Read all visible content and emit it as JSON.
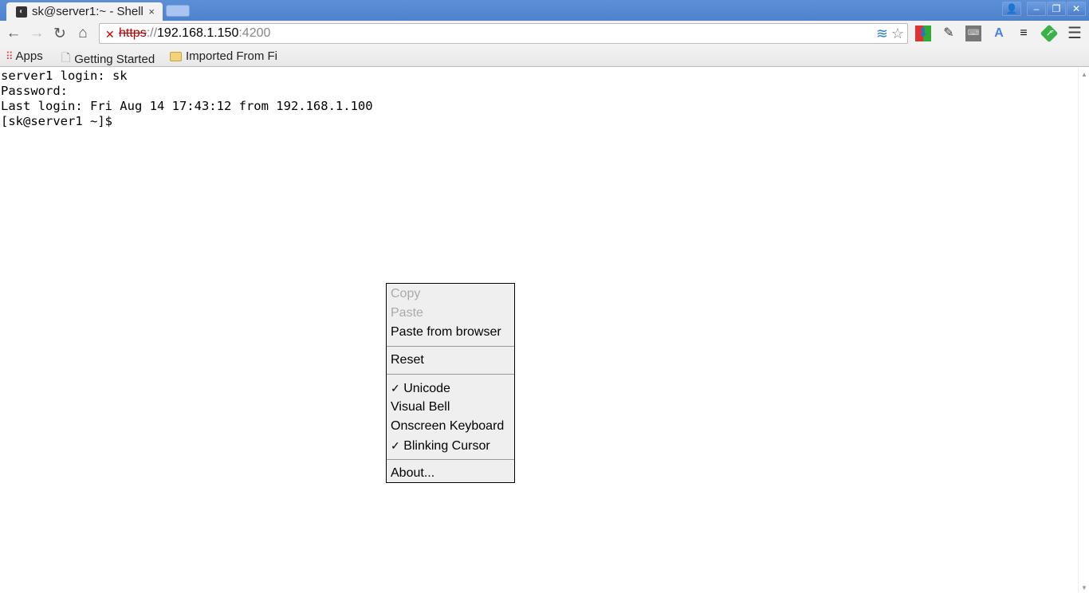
{
  "browser": {
    "tab_title": "sk@server1:~ - Shell",
    "tab_close": "×",
    "url_scheme": "https",
    "url_sep": "://",
    "url_host": "192.168.1.150",
    "url_port": ":4200",
    "bookmarks": [
      {
        "label": "Apps",
        "icon": "apps-grid-icon"
      },
      {
        "label": "Getting Started",
        "icon": "page-icon"
      },
      {
        "label": "Imported From Fi",
        "icon": "folder-icon"
      }
    ]
  },
  "terminal": {
    "lines": [
      "server1 login: sk",
      "Password:",
      "Last login: Fri Aug 14 17:43:12 from 192.168.1.100",
      "[sk@server1 ~]$"
    ]
  },
  "menu": {
    "items": [
      {
        "label": "Copy",
        "enabled": false
      },
      {
        "label": "Paste",
        "enabled": false
      },
      {
        "label": "Paste from browser",
        "enabled": true
      },
      {
        "label": "Reset",
        "enabled": true
      },
      {
        "label": "Unicode",
        "checked": true
      },
      {
        "label": "Visual Bell",
        "checked": false
      },
      {
        "label": "Onscreen Keyboard",
        "checked": false
      },
      {
        "label": "Blinking Cursor",
        "checked": true
      },
      {
        "label": "About...",
        "enabled": true
      }
    ],
    "check_mark": "✓"
  }
}
